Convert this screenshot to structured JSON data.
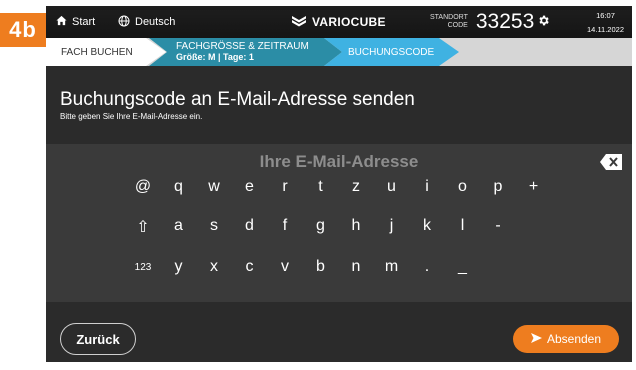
{
  "badge": "4b",
  "topbar": {
    "home_label": "Start",
    "language_label": "Deutsch",
    "brand": "VARIOCUBE",
    "standort_label_1": "STANDORT",
    "standort_label_2": "CODE",
    "standort_code": "33253",
    "time": "16:07",
    "date": "14.11.2022"
  },
  "breadcrumbs": {
    "step1": "FACH BUCHEN",
    "step2_title": "FACHGRÖSSE & ZEITRAUM",
    "step2_sub": "Größe: M | Tage: 1",
    "step3": "BUCHUNGSCODE"
  },
  "main": {
    "title": "Buchungscode an E-Mail-Adresse senden",
    "subtitle": "Bitte geben Sie Ihre E-Mail-Adresse ein."
  },
  "keyboard": {
    "placeholder": "Ihre E-Mail-Adresse",
    "rows": [
      [
        "@",
        "q",
        "w",
        "e",
        "r",
        "t",
        "z",
        "u",
        "i",
        "o",
        "p",
        "+"
      ],
      [
        "⇧",
        "a",
        "s",
        "d",
        "f",
        "g",
        "h",
        "j",
        "k",
        "l",
        "-"
      ],
      [
        "123",
        "y",
        "x",
        "c",
        "v",
        "b",
        "n",
        "m",
        ".",
        "_"
      ]
    ]
  },
  "footer": {
    "back_label": "Zurück",
    "send_label": "Absenden"
  },
  "colors": {
    "accent_orange": "#ee7d1f",
    "step_active_blue": "#3fb2e2",
    "step_done_teal": "#2b8da6"
  }
}
